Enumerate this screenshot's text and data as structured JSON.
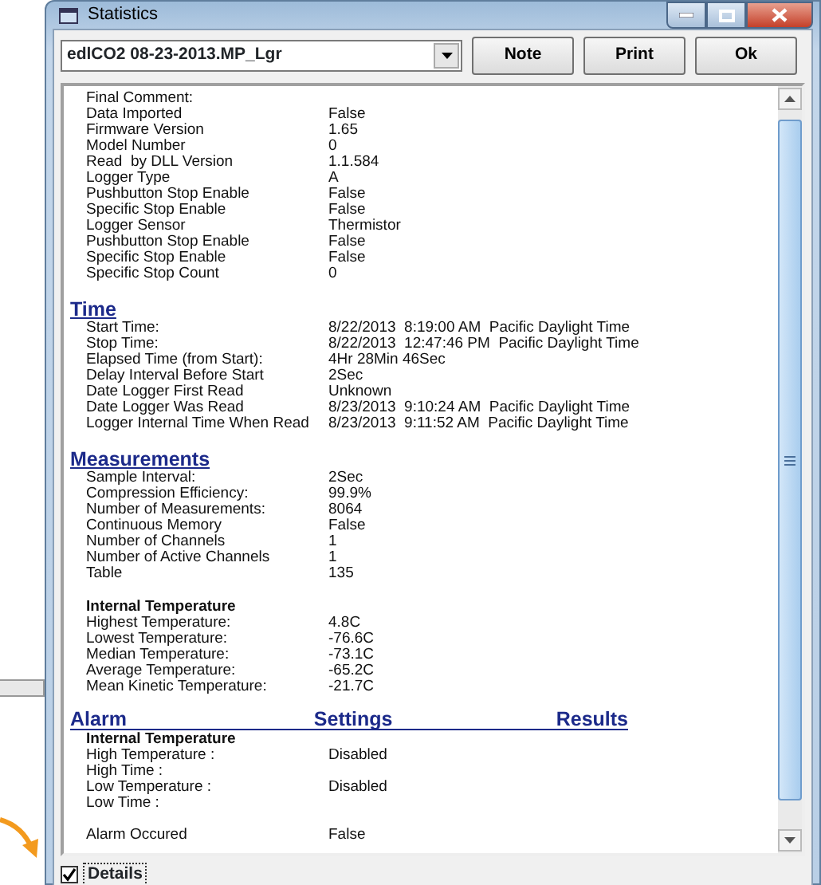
{
  "window": {
    "title": "Statistics"
  },
  "file_select": {
    "value": "edlCO2 08-23-2013.MP_Lgr"
  },
  "buttons": [
    "Note",
    "Print",
    "Ok"
  ],
  "items": [
    {
      "kind": "row",
      "label": "Final Comment:",
      "value": ""
    },
    {
      "kind": "row",
      "label": "Data Imported",
      "value": "False"
    },
    {
      "kind": "row",
      "label": "Firmware Version",
      "value": "1.65"
    },
    {
      "kind": "row",
      "label": "Model Number",
      "value": "0"
    },
    {
      "kind": "row",
      "label": "Read  by DLL Version",
      "value": "1.1.584"
    },
    {
      "kind": "row",
      "label": "Logger Type",
      "value": "A"
    },
    {
      "kind": "row",
      "label": "Pushbutton Stop Enable",
      "value": "False"
    },
    {
      "kind": "row",
      "label": "Specific Stop Enable",
      "value": "False"
    },
    {
      "kind": "row",
      "label": "Logger Sensor",
      "value": "Thermistor"
    },
    {
      "kind": "row",
      "label": "Pushbutton Stop Enable",
      "value": "False"
    },
    {
      "kind": "row",
      "label": "Specific Stop Enable",
      "value": "False"
    },
    {
      "kind": "row",
      "label": "Specific Stop Count",
      "value": "0"
    },
    {
      "kind": "heading",
      "columns": [
        "Time"
      ]
    },
    {
      "kind": "row",
      "label": "Start Time:",
      "value": "8/22/2013  8:19:00 AM  Pacific Daylight Time"
    },
    {
      "kind": "row",
      "label": "Stop Time:",
      "value": "8/22/2013  12:47:46 PM  Pacific Daylight Time"
    },
    {
      "kind": "row",
      "label": "Elapsed Time (from Start):",
      "value": "4Hr 28Min 46Sec"
    },
    {
      "kind": "row",
      "label": "Delay Interval Before Start",
      "value": "2Sec"
    },
    {
      "kind": "row",
      "label": "Date Logger First Read",
      "value": "Unknown"
    },
    {
      "kind": "row",
      "label": "Date Logger Was Read",
      "value": "8/23/2013  9:10:24 AM  Pacific Daylight Time"
    },
    {
      "kind": "row",
      "label": "Logger Internal Time When Read",
      "value": "8/23/2013  9:11:52 AM  Pacific Daylight Time"
    },
    {
      "kind": "heading",
      "columns": [
        "Measurements"
      ]
    },
    {
      "kind": "row",
      "label": "Sample Interval:",
      "value": "2Sec"
    },
    {
      "kind": "row",
      "label": "Compression Efficiency:",
      "value": "99.9%"
    },
    {
      "kind": "row",
      "label": "Number of Measurements:",
      "value": "8064"
    },
    {
      "kind": "row",
      "label": "Continuous Memory",
      "value": "False"
    },
    {
      "kind": "row",
      "label": "Number of Channels",
      "value": "1"
    },
    {
      "kind": "row",
      "label": "Number of Active Channels",
      "value": "1"
    },
    {
      "kind": "row",
      "label": "Table",
      "value": "135"
    },
    {
      "kind": "gap"
    },
    {
      "kind": "subheading",
      "label": "Internal Temperature"
    },
    {
      "kind": "row",
      "label": "Highest Temperature:",
      "value": "4.8C"
    },
    {
      "kind": "row",
      "label": "Lowest Temperature:",
      "value": "-76.6C"
    },
    {
      "kind": "row",
      "label": "Median Temperature:",
      "value": "-73.1C"
    },
    {
      "kind": "row",
      "label": "Average Temperature:",
      "value": "-65.2C"
    },
    {
      "kind": "row",
      "label": "Mean Kinetic Temperature:",
      "value": "-21.7C"
    },
    {
      "kind": "heading",
      "columns": [
        "Alarm",
        "Settings",
        "Results"
      ]
    },
    {
      "kind": "subheading",
      "label": "Internal Temperature"
    },
    {
      "kind": "row",
      "label": "High Temperature :",
      "value": "Disabled"
    },
    {
      "kind": "row",
      "label": "High Time :",
      "value": ""
    },
    {
      "kind": "row",
      "label": "Low Temperature :",
      "value": "Disabled"
    },
    {
      "kind": "row",
      "label": "Low Time :",
      "value": ""
    },
    {
      "kind": "gap"
    },
    {
      "kind": "row",
      "label": "Alarm Occured",
      "value": "False"
    }
  ],
  "details": {
    "label": "Details",
    "checked": true
  }
}
